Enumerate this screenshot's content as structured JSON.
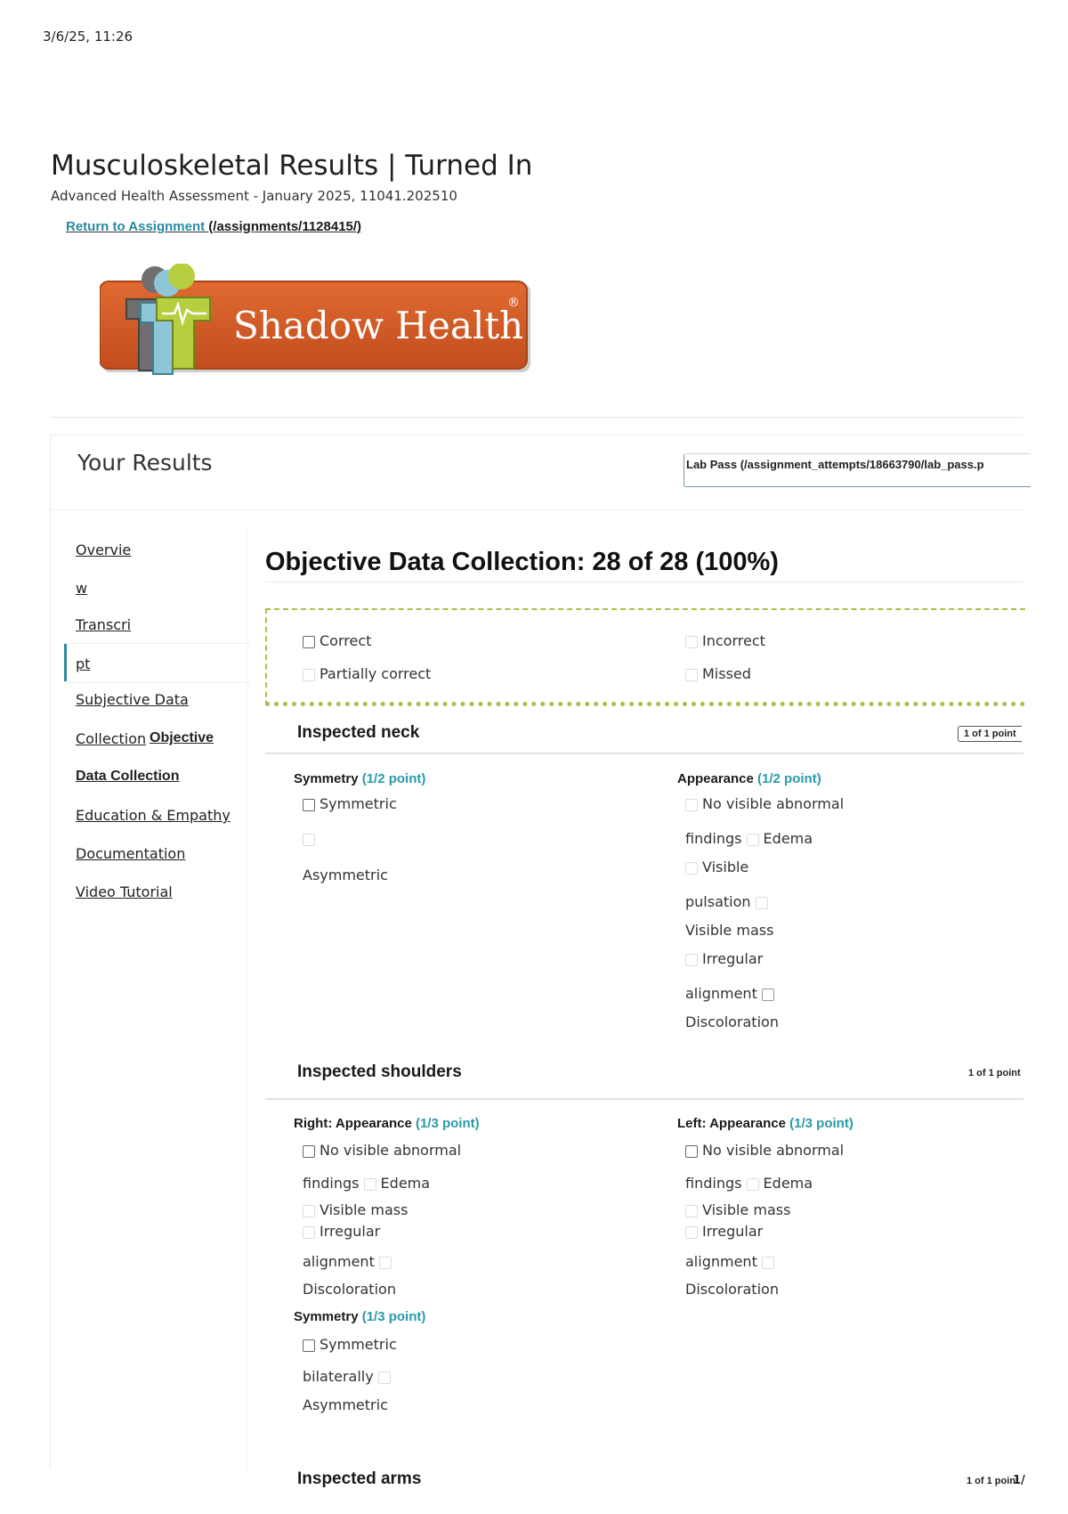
{
  "timestamp": "3/6/25, 11:26",
  "header": {
    "title": "Musculoskeletal Results | Turned In",
    "subtitle": "Advanced Health Assessment - January 2025, 11041.202510",
    "return_label": "Return to Assignment",
    "return_url": "(/assignments/1128415/)"
  },
  "logo": {
    "text": "Shadow Health",
    "reg": "®",
    "colors": {
      "orange": "#cf5a26",
      "green": "#a8c43a",
      "gray": "#6f6f6f"
    }
  },
  "results": {
    "heading": "Your Results",
    "lab_pass": "Lab Pass (/assignment_attempts/18663790/lab_pass.p"
  },
  "sidebar": {
    "items": [
      "Overvie",
      "w",
      "Transcri",
      "pt",
      "Subjective Data",
      "Collection",
      "Objective",
      "Data Collection",
      "Education & Empathy",
      "Documentation",
      "Video Tutorial"
    ]
  },
  "main": {
    "section_title": "Objective Data Collection: 28 of 28 (100%)",
    "legend": {
      "correct": "Correct",
      "incorrect": "Incorrect",
      "partial": "Partially correct",
      "missed": "Missed"
    },
    "groups": [
      {
        "title": "Inspected neck",
        "points": "1 of 1 point",
        "left": {
          "label": "Symmetry",
          "pts": "(1/2 point)",
          "options": [
            "Symmetric",
            "Asymmetric"
          ]
        },
        "right": {
          "label": "Appearance",
          "pts": "(1/2 point)",
          "options": [
            "No visible abnormal",
            "findings",
            "Edema",
            "Visible",
            "pulsation",
            "Visible mass",
            "Irregular",
            "alignment",
            "Discoloration"
          ]
        }
      },
      {
        "title": "Inspected shoulders",
        "points": "1 of 1 point",
        "left": {
          "label": "Right: Appearance",
          "pts": "(1/3 point)",
          "options": [
            "No visible abnormal",
            "findings",
            "Edema",
            "Visible mass",
            "Irregular",
            "alignment",
            "Discoloration"
          ]
        },
        "right": {
          "label": "Left: Appearance",
          "pts": "(1/3 point)",
          "options": [
            "No visible abnormal",
            "findings",
            "Edema",
            "Visible mass",
            "Irregular",
            "alignment",
            "Discoloration"
          ]
        },
        "sym": {
          "label": "Symmetry",
          "pts": "(1/3 point)",
          "options": [
            "Symmetric",
            "bilaterally",
            "Asymmetric"
          ]
        }
      },
      {
        "title": "Inspected arms",
        "points": "1 of 1 point"
      }
    ]
  },
  "page_mark": "1/"
}
